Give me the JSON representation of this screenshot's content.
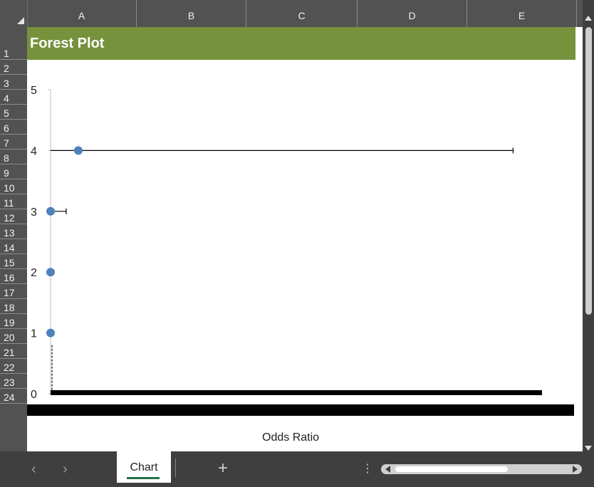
{
  "columns": [
    "A",
    "B",
    "C",
    "D",
    "E"
  ],
  "rows": [
    "1",
    "2",
    "3",
    "4",
    "5",
    "6",
    "7",
    "8",
    "9",
    "10",
    "11",
    "12",
    "13",
    "14",
    "15",
    "16",
    "17",
    "18",
    "19",
    "20",
    "21",
    "22",
    "23",
    "24"
  ],
  "sheet_title": "Forest Plot",
  "tabs": [
    {
      "label": "Chart",
      "active": true
    }
  ],
  "tab_nav": {
    "prev": "‹",
    "next": "›",
    "add": "+",
    "more": "⋮"
  },
  "colors": {
    "title_bg": "#76923c",
    "point": "#4f81bd",
    "active_tab_underline": "#217346"
  },
  "chart_data": {
    "type": "scatter",
    "title": "",
    "xlabel": "Odds Ratio",
    "ylabel": "",
    "ylim": [
      0,
      5
    ],
    "yticks": [
      "0",
      "1",
      "2",
      "3",
      "4",
      "5"
    ],
    "reference_line": {
      "x": 1,
      "style": "dashed"
    },
    "points": [
      {
        "y": 1,
        "x": 1.0,
        "ci_low": 1.0,
        "ci_high": 1.0
      },
      {
        "y": 2,
        "x": 1.0,
        "ci_low": 1.0,
        "ci_high": 1.0
      },
      {
        "y": 3,
        "x": 1.0,
        "ci_low": 1.0,
        "ci_high": 1.27
      },
      {
        "y": 4,
        "x": 1.48,
        "ci_low": 1.0,
        "ci_high": 9.0
      }
    ],
    "xlim": [
      1.0,
      9.5
    ],
    "x_tick_labels_overlapping": true,
    "grid": false
  }
}
